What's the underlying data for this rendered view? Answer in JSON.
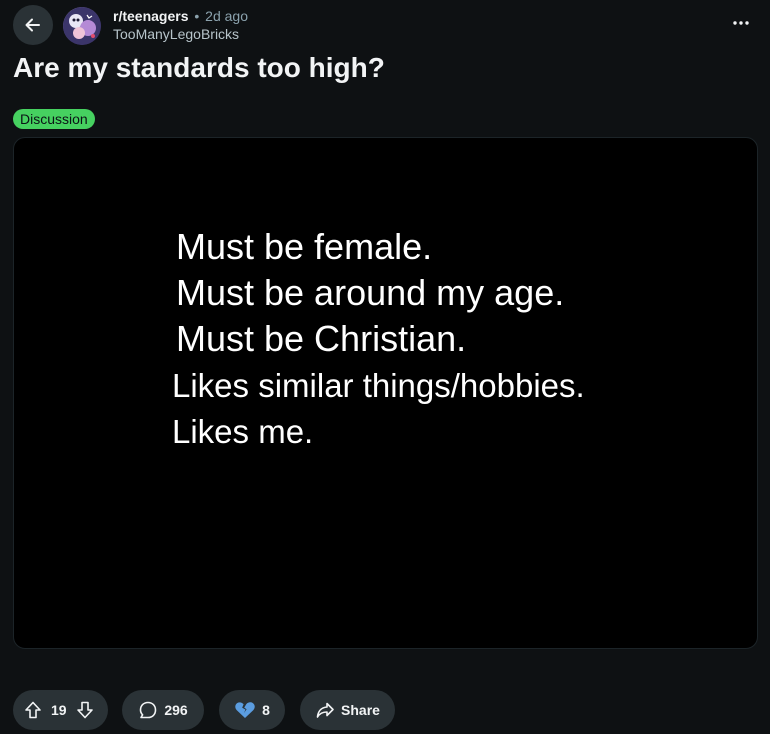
{
  "post": {
    "subreddit": "r/teenagers",
    "separator": "•",
    "age": "2d ago",
    "author": "TooManyLegoBricks",
    "title": "Are my standards too high?",
    "flair": "Discussion",
    "image_lines": [
      "Must be female.",
      "Must be around my age.",
      "Must be Christian.",
      "Likes similar things/hobbies.",
      "Likes me."
    ]
  },
  "actions": {
    "score": "19",
    "comments": "296",
    "awards": "8",
    "share_label": "Share"
  },
  "icons": {
    "back": "arrow-left-icon",
    "overflow": "ellipsis-icon",
    "upvote": "arrow-up-icon",
    "downvote": "arrow-down-icon",
    "comment": "speech-bubble-icon",
    "award": "broken-heart-icon",
    "share": "share-arrow-icon"
  },
  "colors": {
    "background": "#0e1113",
    "button": "#2a3236",
    "flair": "#46d160",
    "award": "#5b9de0"
  }
}
